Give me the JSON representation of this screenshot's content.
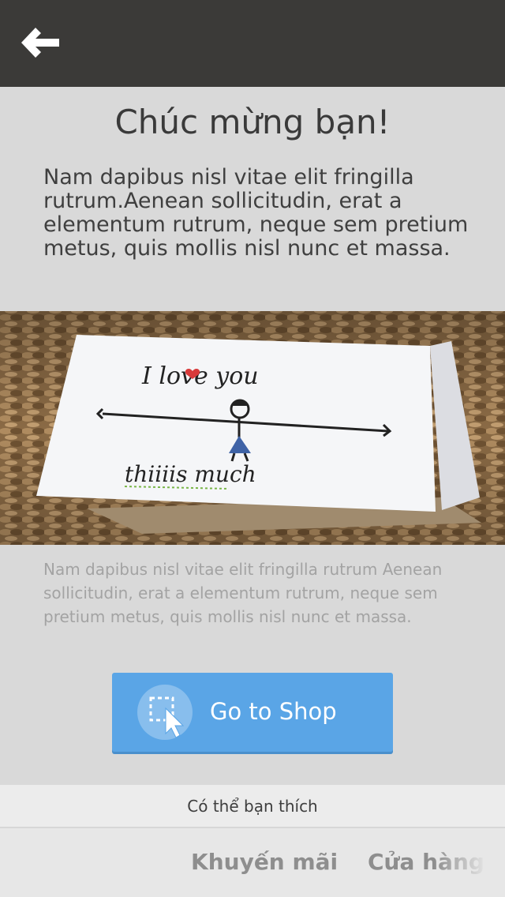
{
  "header": {
    "back_icon": "arrow-left-icon",
    "background": "#3b3a38"
  },
  "main": {
    "title": "Chúc mừng bạn!",
    "lead": "Nam dapibus nisl vitae elit fringilla rutrum.Aenean sollicitudin, erat a elementum rutrum, neque sem pretium metus, quis mollis nisl nunc et massa.",
    "photo": {
      "line_1": "I love you",
      "line_2": "thiiiis much"
    },
    "caption": "Nam dapibus nisl vitae elit fringilla rutrum Aenean sollicitudin, erat a elementum rutrum, neque sem pretium metus, quis mollis nisl nunc et massa.",
    "shop_button": {
      "label": "Go to Shop",
      "icon": "cursor-select-icon",
      "color": "#5aa5e6"
    }
  },
  "suggest": {
    "label": "Có thể bạn thích"
  },
  "tabs": [
    {
      "label": "Khuyến mãi"
    },
    {
      "label": "Cửa hàng"
    }
  ]
}
